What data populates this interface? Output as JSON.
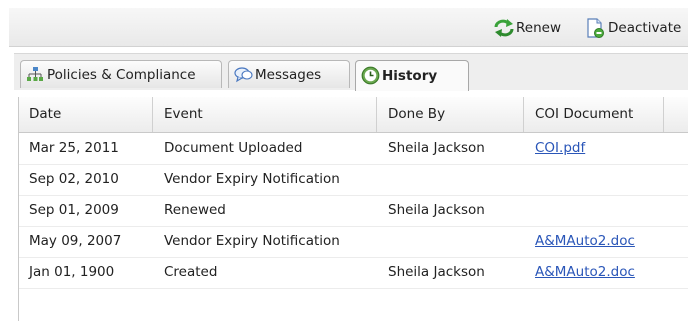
{
  "toolbar": {
    "renew_label": "Renew",
    "deactivate_label": "Deactivate",
    "renew_icon": "renew-arrows-icon",
    "deactivate_icon": "deactivate-document-icon"
  },
  "tabs": [
    {
      "label": "Policies & Compliance",
      "icon": "org-chart-icon"
    },
    {
      "label": "Messages",
      "icon": "speech-bubbles-icon"
    },
    {
      "label": "History",
      "icon": "clock-icon",
      "active": true
    }
  ],
  "grid": {
    "columns": [
      "Date",
      "Event",
      "Done By",
      "COI Document"
    ],
    "rows": [
      {
        "date": "Mar 25, 2011",
        "event": "Document Uploaded",
        "done_by": "Sheila Jackson",
        "doc": "COI.pdf"
      },
      {
        "date": "Sep 02, 2010",
        "event": "Vendor Expiry Notification",
        "done_by": "",
        "doc": ""
      },
      {
        "date": "Sep 01, 2009",
        "event": "Renewed",
        "done_by": "Sheila Jackson",
        "doc": ""
      },
      {
        "date": "May 09, 2007",
        "event": "Vendor Expiry Notification",
        "done_by": "",
        "doc": "A&MAuto2.doc"
      },
      {
        "date": "Jan 01, 1900",
        "event": "Created",
        "done_by": "Sheila Jackson",
        "doc": "A&MAuto2.doc"
      }
    ]
  },
  "colors": {
    "link": "#2a56b8",
    "renew_green": "#3aa23a"
  }
}
